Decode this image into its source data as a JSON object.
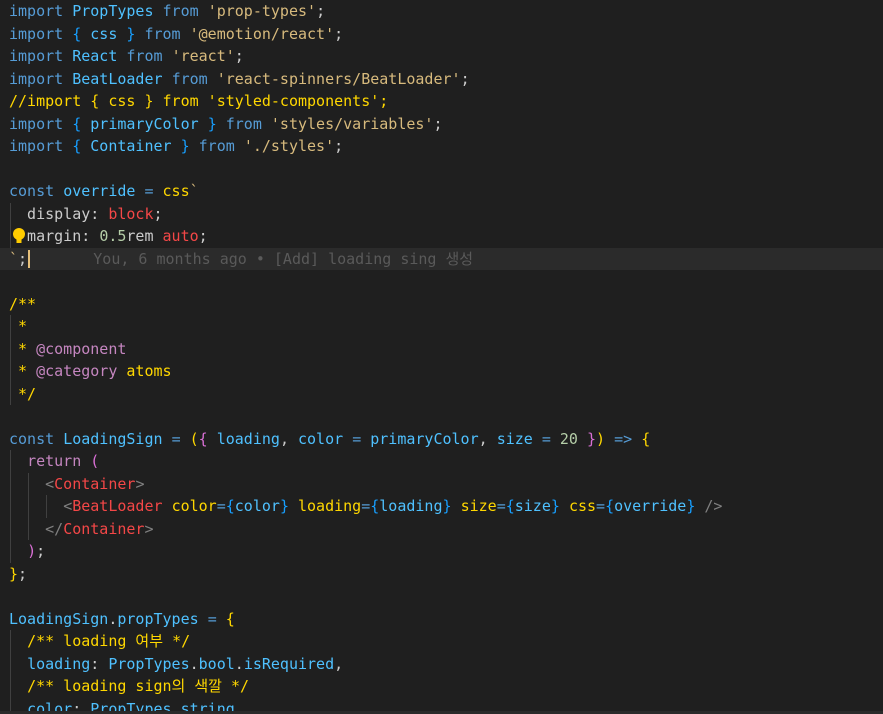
{
  "editor": {
    "colors": {
      "keyword": "#c586c0",
      "import_keyword": "#569cd6",
      "identifier": "#4fc1ff",
      "variable": "#9cdcfe",
      "string": "#ce9178",
      "string_alt": "#d7ba7d",
      "comment": "#6a9955",
      "function": "#dcdcaa",
      "tag": "#f44747",
      "attr": "#d19a66",
      "number": "#b5cea8",
      "brace_yellow": "#ffd700",
      "brace_purple": "#da70d6",
      "brace_blue": "#179fff",
      "plain": "#cccccc",
      "lightbulb": "#ffcc00"
    },
    "lightbulb_icon": "lightbulb-icon",
    "lines": [
      {
        "t": [
          [
            "import",
            "#569cd6"
          ],
          [
            " "
          ],
          [
            "PropTypes",
            "#4fc1ff"
          ],
          [
            " "
          ],
          [
            "from",
            "#569cd6"
          ],
          [
            " "
          ],
          [
            "'prop-types'",
            "#d7ba7d"
          ],
          [
            ";"
          ]
        ]
      },
      {
        "t": [
          [
            "import",
            "#569cd6"
          ],
          [
            " "
          ],
          [
            "{",
            "#179fff"
          ],
          [
            " "
          ],
          [
            "css",
            "#4fc1ff"
          ],
          [
            " "
          ],
          [
            "}",
            "#179fff"
          ],
          [
            " "
          ],
          [
            "from",
            "#569cd6"
          ],
          [
            " "
          ],
          [
            "'@emotion/react'",
            "#d7ba7d"
          ],
          [
            ";"
          ]
        ]
      },
      {
        "t": [
          [
            "import",
            "#569cd6"
          ],
          [
            " "
          ],
          [
            "React",
            "#4fc1ff"
          ],
          [
            " "
          ],
          [
            "from",
            "#569cd6"
          ],
          [
            " "
          ],
          [
            "'react'",
            "#d7ba7d"
          ],
          [
            ";"
          ]
        ]
      },
      {
        "t": [
          [
            "import",
            "#569cd6"
          ],
          [
            " "
          ],
          [
            "BeatLoader",
            "#4fc1ff"
          ],
          [
            " "
          ],
          [
            "from",
            "#569cd6"
          ],
          [
            " "
          ],
          [
            "'react-spinners/BeatLoader'",
            "#d7ba7d"
          ],
          [
            ";"
          ]
        ]
      },
      {
        "t": [
          [
            "//import { css } from 'styled-components';",
            "#ffd700"
          ]
        ]
      },
      {
        "t": [
          [
            "import",
            "#569cd6"
          ],
          [
            " "
          ],
          [
            "{",
            "#179fff"
          ],
          [
            " "
          ],
          [
            "primaryColor",
            "#4fc1ff"
          ],
          [
            " "
          ],
          [
            "}",
            "#179fff"
          ],
          [
            " "
          ],
          [
            "from",
            "#569cd6"
          ],
          [
            " "
          ],
          [
            "'styles/variables'",
            "#d7ba7d"
          ],
          [
            ";"
          ]
        ]
      },
      {
        "t": [
          [
            "import",
            "#569cd6"
          ],
          [
            " "
          ],
          [
            "{",
            "#179fff"
          ],
          [
            " "
          ],
          [
            "Container",
            "#4fc1ff"
          ],
          [
            " "
          ],
          [
            "}",
            "#179fff"
          ],
          [
            " "
          ],
          [
            "from",
            "#569cd6"
          ],
          [
            " "
          ],
          [
            "'./styles'",
            "#d7ba7d"
          ],
          [
            ";"
          ]
        ]
      },
      {
        "t": []
      },
      {
        "t": [
          [
            "const",
            "#569cd6"
          ],
          [
            " "
          ],
          [
            "override",
            "#4fc1ff"
          ],
          [
            " "
          ],
          [
            "=",
            "#569cd6"
          ],
          [
            " "
          ],
          [
            "css",
            "#ffd700"
          ],
          [
            "`",
            "#d7ba7d"
          ]
        ]
      },
      {
        "t": [
          [
            "  display",
            "#cccccc"
          ],
          [
            ": ",
            "#cccccc"
          ],
          [
            "block",
            "#f44747"
          ],
          [
            ";"
          ]
        ],
        "guide": true
      },
      {
        "t": [
          [
            "  margin",
            "#cccccc"
          ],
          [
            ": ",
            "#cccccc"
          ],
          [
            "0.5",
            "#b5cea8"
          ],
          [
            "rem",
            "#cccccc"
          ],
          [
            " "
          ],
          [
            "auto",
            "#f44747"
          ],
          [
            ";"
          ]
        ],
        "guide": true,
        "bulb": true
      },
      {
        "t": [
          [
            "`",
            "#d7ba7d"
          ],
          [
            ";"
          ]
        ],
        "current": true,
        "cursor": true,
        "blame": "       You, 6 months ago • [Add] loading sing 생성"
      },
      {
        "t": []
      },
      {
        "t": [
          [
            "/**",
            "#ffd700"
          ]
        ]
      },
      {
        "t": [
          [
            " *",
            "#ffd700"
          ]
        ],
        "guide": true
      },
      {
        "t": [
          [
            " * ",
            "#ffd700"
          ],
          [
            "@component",
            "#c586c0"
          ]
        ],
        "guide": true
      },
      {
        "t": [
          [
            " * ",
            "#ffd700"
          ],
          [
            "@category",
            "#c586c0"
          ],
          [
            " "
          ],
          [
            "atoms",
            "#ffd700"
          ]
        ],
        "guide": true
      },
      {
        "t": [
          [
            " */",
            "#ffd700"
          ]
        ],
        "guide": true
      },
      {
        "t": []
      },
      {
        "t": [
          [
            "const",
            "#569cd6"
          ],
          [
            " "
          ],
          [
            "LoadingSign",
            "#4fc1ff"
          ],
          [
            " "
          ],
          [
            "=",
            "#569cd6"
          ],
          [
            " "
          ],
          [
            "(",
            "#ffd700"
          ],
          [
            "{",
            "#da70d6"
          ],
          [
            " "
          ],
          [
            "loading",
            "#4fc1ff"
          ],
          [
            ", "
          ],
          [
            "color",
            "#4fc1ff"
          ],
          [
            " "
          ],
          [
            "=",
            "#569cd6"
          ],
          [
            " "
          ],
          [
            "primaryColor",
            "#4fc1ff"
          ],
          [
            ", "
          ],
          [
            "size",
            "#4fc1ff"
          ],
          [
            " "
          ],
          [
            "=",
            "#569cd6"
          ],
          [
            " "
          ],
          [
            "20",
            "#b5cea8"
          ],
          [
            " "
          ],
          [
            "}",
            "#da70d6"
          ],
          [
            ")",
            "#ffd700"
          ],
          [
            " "
          ],
          [
            "=>",
            "#569cd6"
          ],
          [
            " "
          ],
          [
            "{",
            "#ffd700"
          ]
        ]
      },
      {
        "t": [
          [
            "  "
          ],
          [
            "return",
            "#c586c0"
          ],
          [
            " "
          ],
          [
            "(",
            "#da70d6"
          ]
        ],
        "guide": true
      },
      {
        "t": [
          [
            "    "
          ],
          [
            "<",
            "#808080"
          ],
          [
            "Container",
            "#f44747"
          ],
          [
            ">",
            "#808080"
          ]
        ],
        "guide": true,
        "guide2": true
      },
      {
        "t": [
          [
            "      "
          ],
          [
            "<",
            "#808080"
          ],
          [
            "BeatLoader",
            "#f44747"
          ],
          [
            " "
          ],
          [
            "color",
            "#ffd700"
          ],
          [
            "=",
            "#569cd6"
          ],
          [
            "{",
            "#179fff"
          ],
          [
            "color",
            "#4fc1ff"
          ],
          [
            "}",
            "#179fff"
          ],
          [
            " "
          ],
          [
            "loading",
            "#ffd700"
          ],
          [
            "=",
            "#569cd6"
          ],
          [
            "{",
            "#179fff"
          ],
          [
            "loading",
            "#4fc1ff"
          ],
          [
            "}",
            "#179fff"
          ],
          [
            " "
          ],
          [
            "size",
            "#ffd700"
          ],
          [
            "=",
            "#569cd6"
          ],
          [
            "{",
            "#179fff"
          ],
          [
            "size",
            "#4fc1ff"
          ],
          [
            "}",
            "#179fff"
          ],
          [
            " "
          ],
          [
            "css",
            "#ffd700"
          ],
          [
            "=",
            "#569cd6"
          ],
          [
            "{",
            "#179fff"
          ],
          [
            "override",
            "#4fc1ff"
          ],
          [
            "}",
            "#179fff"
          ],
          [
            " "
          ],
          [
            "/>",
            "#808080"
          ]
        ],
        "guide": true,
        "guide2": true,
        "guide3": true
      },
      {
        "t": [
          [
            "    "
          ],
          [
            "</",
            "#808080"
          ],
          [
            "Container",
            "#f44747"
          ],
          [
            ">",
            "#808080"
          ]
        ],
        "guide": true,
        "guide2": true
      },
      {
        "t": [
          [
            "  "
          ],
          [
            ")",
            "#da70d6"
          ],
          [
            ";"
          ]
        ],
        "guide": true
      },
      {
        "t": [
          [
            "}",
            "#ffd700"
          ],
          [
            ";"
          ]
        ]
      },
      {
        "t": []
      },
      {
        "t": [
          [
            "LoadingSign",
            "#4fc1ff"
          ],
          [
            "."
          ],
          [
            "propTypes",
            "#4fc1ff"
          ],
          [
            " "
          ],
          [
            "=",
            "#569cd6"
          ],
          [
            " "
          ],
          [
            "{",
            "#ffd700"
          ]
        ]
      },
      {
        "t": [
          [
            "  "
          ],
          [
            "/** loading 여부 */",
            "#ffd700"
          ]
        ],
        "guide": true
      },
      {
        "t": [
          [
            "  "
          ],
          [
            "loading",
            "#4fc1ff"
          ],
          [
            ": "
          ],
          [
            "PropTypes",
            "#4fc1ff"
          ],
          [
            "."
          ],
          [
            "bool",
            "#4fc1ff"
          ],
          [
            "."
          ],
          [
            "isRequired",
            "#4fc1ff"
          ],
          [
            ","
          ]
        ],
        "guide": true
      },
      {
        "t": [
          [
            "  "
          ],
          [
            "/** loading sign의 색깔 */",
            "#ffd700"
          ]
        ],
        "guide": true
      },
      {
        "t": [
          [
            "  "
          ],
          [
            "color",
            "#4fc1ff"
          ],
          [
            ": "
          ],
          [
            "PropTypes",
            "#4fc1ff"
          ],
          [
            "."
          ],
          [
            "string",
            "#4fc1ff"
          ]
        ],
        "guide": true
      }
    ]
  }
}
